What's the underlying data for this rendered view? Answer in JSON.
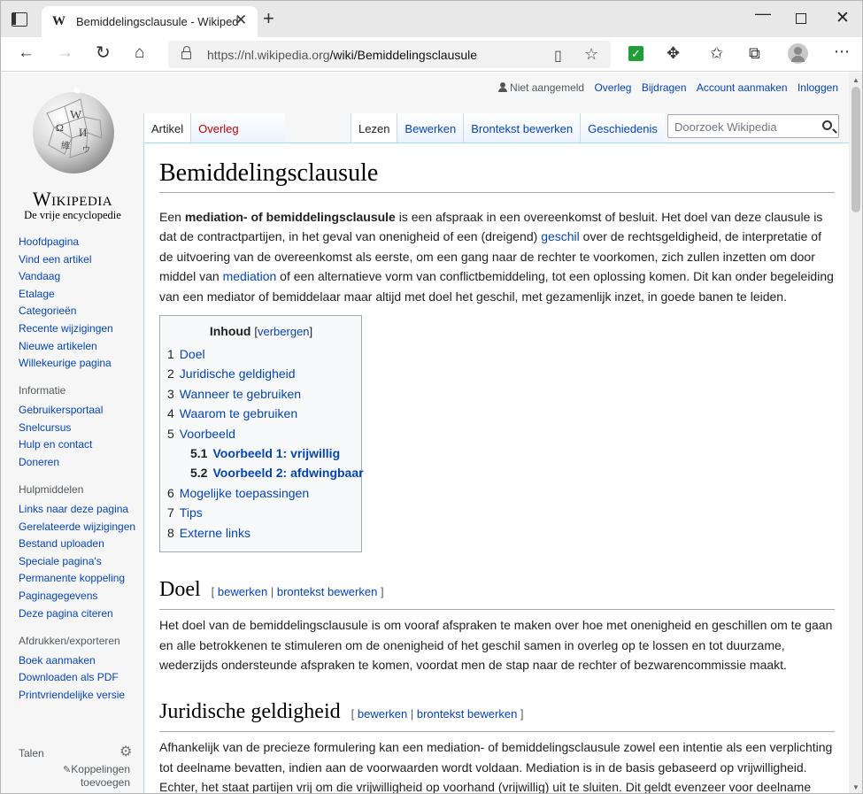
{
  "browser": {
    "tab_title": "Bemiddelingsclausule - Wikiped",
    "tab_favicon": "W",
    "url_host": "https://nl.wikipedia.org",
    "url_path": "/wiki/Bemiddelingsclausule"
  },
  "logo": {
    "wordmark": "Wikipedia",
    "tagline": "De vrije encyclopedie"
  },
  "nav": {
    "main": [
      "Hoofdpagina",
      "Vind een artikel",
      "Vandaag",
      "Etalage",
      "Categorieën",
      "Recente wijzigingen",
      "Nieuwe artikelen",
      "Willekeurige pagina"
    ],
    "info_heading": "Informatie",
    "info": [
      "Gebruikersportaal",
      "Snelcursus",
      "Hulp en contact",
      "Doneren"
    ],
    "tools_heading": "Hulpmiddelen",
    "tools": [
      "Links naar deze pagina",
      "Gerelateerde wijzigingen",
      "Bestand uploaden",
      "Speciale pagina's",
      "Permanente koppeling",
      "Paginagegevens",
      "Deze pagina citeren"
    ],
    "print_heading": "Afdrukken/exporteren",
    "print": [
      "Boek aanmaken",
      "Downloaden als PDF",
      "Printvriendelijke versie"
    ],
    "languages_heading": "Talen",
    "add_links": "Koppelingen toevoegen"
  },
  "personal": {
    "status": "Niet aangemeld",
    "links": [
      "Overleg",
      "Bijdragen",
      "Account aanmaken",
      "Inloggen"
    ]
  },
  "tabs": {
    "namespaces": [
      "Artikel",
      "Overleg"
    ],
    "views": [
      "Lezen",
      "Bewerken",
      "Brontekst bewerken",
      "Geschiedenis"
    ]
  },
  "search": {
    "placeholder": "Doorzoek Wikipedia"
  },
  "article": {
    "title": "Bemiddelingsclausule",
    "intro": {
      "p1": "Een ",
      "bold": "mediation- of bemiddelingsclausule",
      "p2": " is een afspraak in een overeenkomst of besluit. Het doel van deze clausule is dat de contractpartijen, in het geval van onenigheid of een (dreigend) ",
      "link1": "geschil",
      "p3": " over de rechtsgeldigheid, de interpretatie of de uitvoering van de overeenkomst als eerste, om een gang naar de rechter te voorkomen,  zich zullen inzetten om door middel van ",
      "link2": "mediation",
      "p4": " of een alternatieve vorm van conflictbemiddeling, tot een oplossing komen. Dit kan onder begeleiding van een mediator of bemiddelaar maar altijd met doel het geschil, met gezamenlijk inzet, in goede banen te leiden."
    },
    "toc": {
      "title": "Inhoud",
      "toggle": "verbergen",
      "items": [
        {
          "num": "1",
          "text": "Doel"
        },
        {
          "num": "2",
          "text": "Juridische geldigheid"
        },
        {
          "num": "3",
          "text": "Wanneer te gebruiken"
        },
        {
          "num": "4",
          "text": "Waarom te gebruiken"
        },
        {
          "num": "5",
          "text": "Voorbeeld"
        },
        {
          "num": "5.1",
          "text": "Voorbeeld 1: vrijwillig"
        },
        {
          "num": "5.2",
          "text": "Voorbeeld 2: afdwingbaar"
        },
        {
          "num": "6",
          "text": "Mogelijke toepassingen"
        },
        {
          "num": "7",
          "text": "Tips"
        },
        {
          "num": "8",
          "text": "Externe links"
        }
      ]
    },
    "edit_label": "bewerken",
    "source_edit_label": "brontekst bewerken",
    "sections": [
      {
        "heading": "Doel",
        "text": "Het doel van de bemiddelingsclausule is om vooraf afspraken te maken over hoe met onenigheid en geschillen om te gaan en alle betrokkenen te stimuleren om de onenigheid of het geschil samen in overleg op te lossen en tot duurzame, wederzijds ondersteunde afspraken te komen, voordat men de stap naar de rechter of bezwarencommissie maakt."
      },
      {
        "heading": "Juridische geldigheid",
        "text": "Afhankelijk van de precieze formulering kan een mediation- of bemiddelingsclausule zowel een intentie als een verplichting tot deelname bevatten, indien aan de voorwaarden wordt voldaan. Mediation is in de basis gebaseerd op vrijwilligheid. Echter, het staat partijen vrij om die vrijwilligheid op voorhand (vrijwillig) uit te sluiten. Dit geldt evenzeer voor deelname aan andere vormen van geschilbeslechting, zoals arbitrage."
      }
    ]
  }
}
